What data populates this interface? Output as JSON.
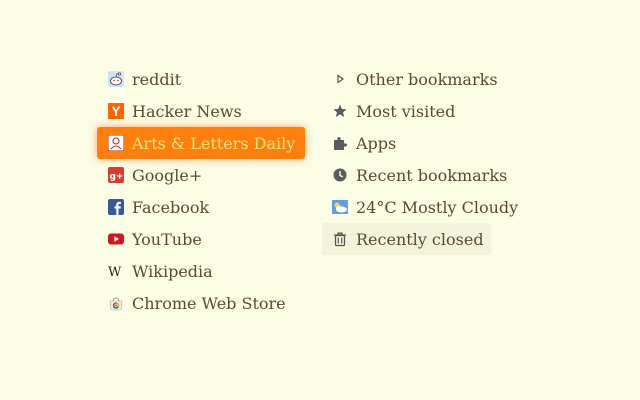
{
  "left_column": [
    {
      "label": "reddit",
      "icon": "reddit-icon"
    },
    {
      "label": "Hacker News",
      "icon": "hacker-news-icon"
    },
    {
      "label": "Arts & Letters Daily",
      "icon": "arts-letters-daily-icon",
      "active": true
    },
    {
      "label": "Google+",
      "icon": "google-plus-icon"
    },
    {
      "label": "Facebook",
      "icon": "facebook-icon"
    },
    {
      "label": "YouTube",
      "icon": "youtube-icon"
    },
    {
      "label": "Wikipedia",
      "icon": "wikipedia-icon"
    },
    {
      "label": "Chrome Web Store",
      "icon": "chrome-web-store-icon"
    }
  ],
  "right_column": [
    {
      "label": "Other bookmarks",
      "icon": "triangle-right-icon"
    },
    {
      "label": "Most visited",
      "icon": "star-icon"
    },
    {
      "label": "Apps",
      "icon": "puzzle-icon"
    },
    {
      "label": "Recent bookmarks",
      "icon": "clock-icon"
    },
    {
      "label": "24°C Mostly Cloudy",
      "icon": "weather-cloudy-icon"
    },
    {
      "label": "Recently closed",
      "icon": "trash-icon",
      "hovered": true
    }
  ],
  "colors": {
    "background": "#fbfde4",
    "text": "#5a4a32",
    "active_bg": "#ff7f0e",
    "active_text": "#ffe27a"
  }
}
